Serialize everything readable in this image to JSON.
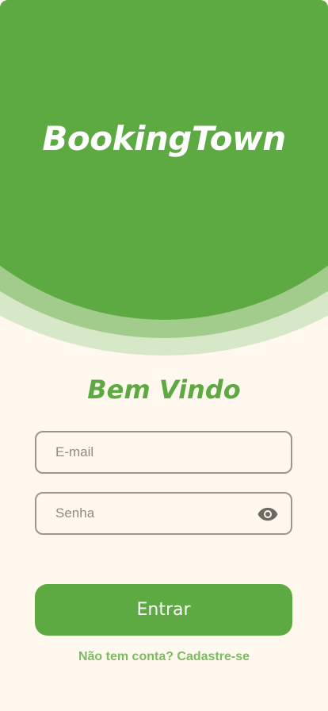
{
  "header": {
    "brand_name": "BookingTown"
  },
  "login": {
    "welcome_title": "Bem Vindo",
    "email_placeholder": "E-mail",
    "password_placeholder": "Senha",
    "password_toggle_icon": "eye-icon",
    "submit_label": "Entrar",
    "signup_link": "Não tem conta? Cadastre-se"
  },
  "colors": {
    "primary_green": "#5eaa42",
    "light_green_wave": "#a2cc8c",
    "pale_green_wave": "#d7e8c8",
    "background": "#fff8ee",
    "border_gray": "#9d968c",
    "link_green": "#7cbb63"
  }
}
